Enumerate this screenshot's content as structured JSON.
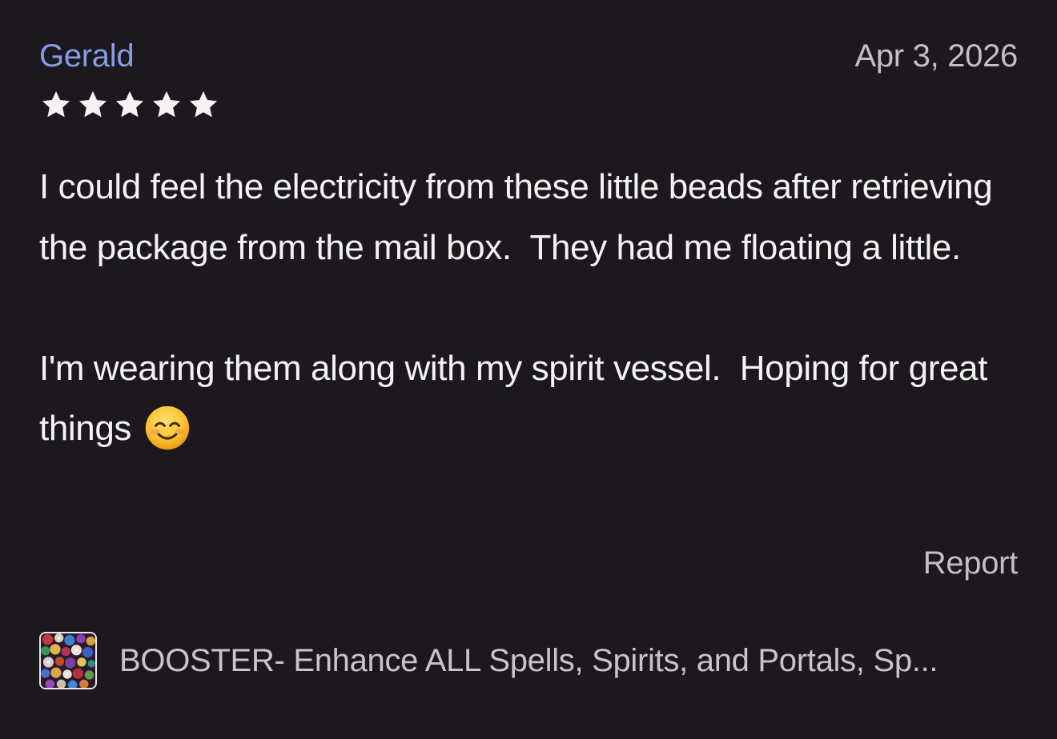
{
  "review": {
    "reviewer_name": "Gerald",
    "date": "Apr 3, 2026",
    "rating": 5,
    "rating_max": 5,
    "paragraph_1": "I could feel the electricity from these little beads after retrieving the package from the mail box.  They had me floating a little.",
    "paragraph_2": "I'm wearing them along with my spirit vessel.  Hoping for great things",
    "emoji": "smiling-face-with-smiling-eyes",
    "report_label": "Report"
  },
  "product": {
    "title": "BOOSTER- Enhance ALL Spells, Spirits, and Portals, Sp...",
    "thumbnail": "beads-thumbnail"
  },
  "colors": {
    "background": "#1c191e",
    "reviewer_name": "#8a9be6",
    "muted_text": "#c4bfc6",
    "star": "#f5f3f4"
  }
}
